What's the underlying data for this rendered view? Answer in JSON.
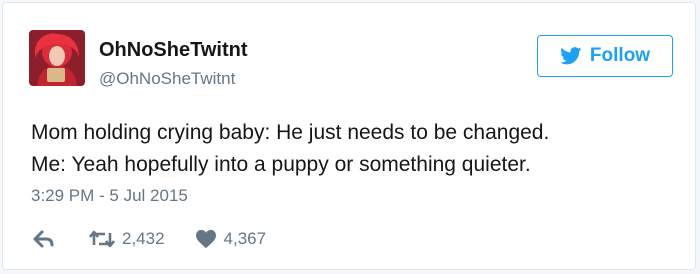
{
  "user": {
    "display_name": "OhNoSheTwitnt",
    "handle": "@OhNoSheTwitnt"
  },
  "follow": {
    "label": "Follow"
  },
  "tweet": {
    "lines": [
      "Mom holding crying baby: He just needs to be changed.",
      "Me: Yeah hopefully into a puppy or something quieter."
    ],
    "timestamp": "3:29 PM - 5 Jul 2015"
  },
  "actions": {
    "retweets": "2,432",
    "likes": "4,367"
  },
  "colors": {
    "accent": "#1da1f2",
    "text": "#14171a",
    "muted": "#657786",
    "border": "#e1e8ed"
  },
  "icons": {
    "follow": "bird-icon",
    "reply": "reply-icon",
    "retweet": "retweet-icon",
    "like": "heart-icon"
  }
}
